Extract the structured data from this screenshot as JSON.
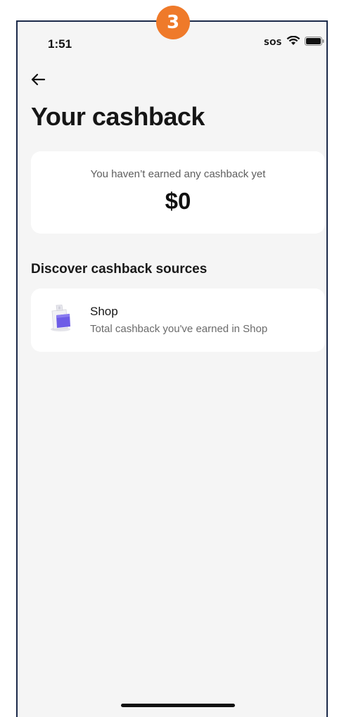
{
  "step_badge": "3",
  "status_bar": {
    "time": "1:51",
    "sos": "SOS"
  },
  "header": {
    "back_icon": "arrow-left-icon",
    "title": "Your cashback"
  },
  "summary": {
    "subtitle": "You haven’t earned any cashback yet",
    "amount": "$0"
  },
  "sources_section": {
    "title": "Discover cashback sources",
    "items": [
      {
        "icon": "shop-bag-icon",
        "name": "Shop",
        "description": "Total cashback you've earned in Shop"
      }
    ]
  },
  "colors": {
    "background": "#f5f5f5",
    "card": "#ffffff",
    "badge": "#ef7a2a",
    "frame_border": "#1c2a4a"
  }
}
